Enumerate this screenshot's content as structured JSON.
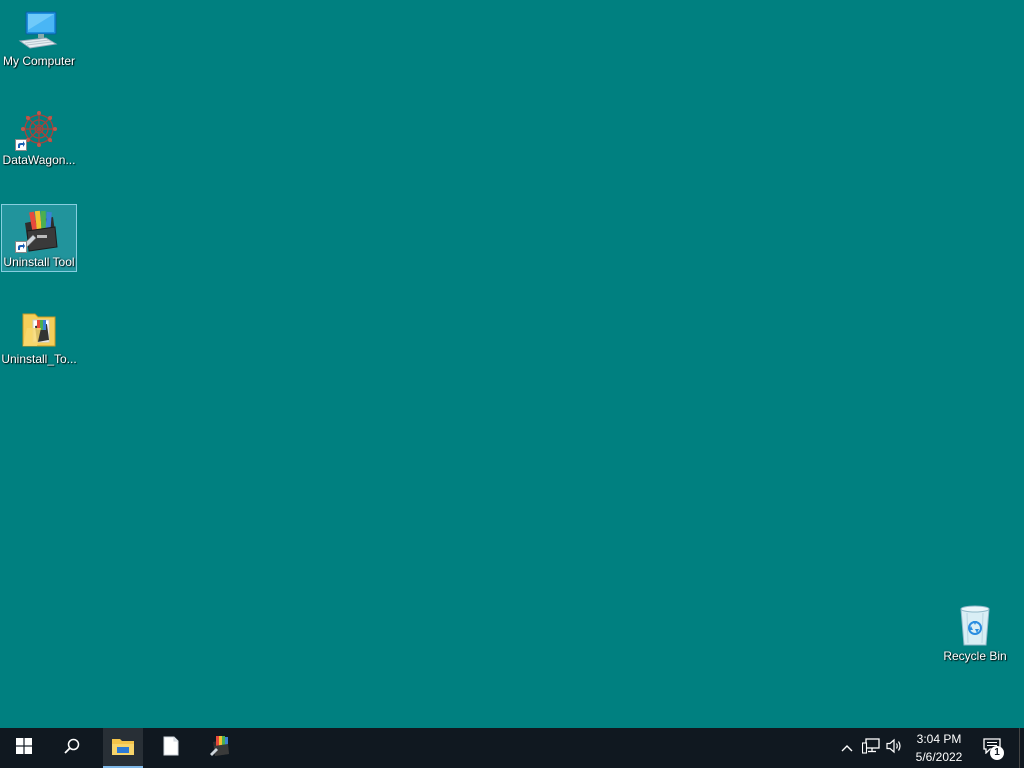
{
  "desktop": {
    "background_color": "#008080",
    "icons": [
      {
        "label": "My Computer",
        "icon": "computer-icon",
        "shortcut": false,
        "selected": false
      },
      {
        "label": "DataWagon...",
        "icon": "datawagon-icon",
        "shortcut": true,
        "selected": false
      },
      {
        "label": "Uninstall Tool",
        "icon": "uninstall-tool-icon",
        "shortcut": true,
        "selected": true
      },
      {
        "label": "Uninstall_To...",
        "icon": "folder-icon",
        "shortcut": false,
        "selected": false
      },
      {
        "label": "Recycle Bin",
        "icon": "recycle-bin-icon",
        "shortcut": false,
        "selected": false
      }
    ]
  },
  "taskbar": {
    "background_color": "#101820",
    "buttons": [
      {
        "name": "start",
        "icon": "windows-logo-icon"
      },
      {
        "name": "search",
        "icon": "search-icon"
      },
      {
        "name": "file-explorer",
        "icon": "file-explorer-icon",
        "active": true
      },
      {
        "name": "notepad",
        "icon": "document-icon"
      },
      {
        "name": "uninstall-tool",
        "icon": "uninstall-tool-icon"
      }
    ],
    "tray": {
      "icons": [
        "chevron-up-icon",
        "network-icon",
        "volume-icon"
      ],
      "time": "3:04 PM",
      "date": "5/6/2022",
      "notifications_count": "1"
    }
  }
}
